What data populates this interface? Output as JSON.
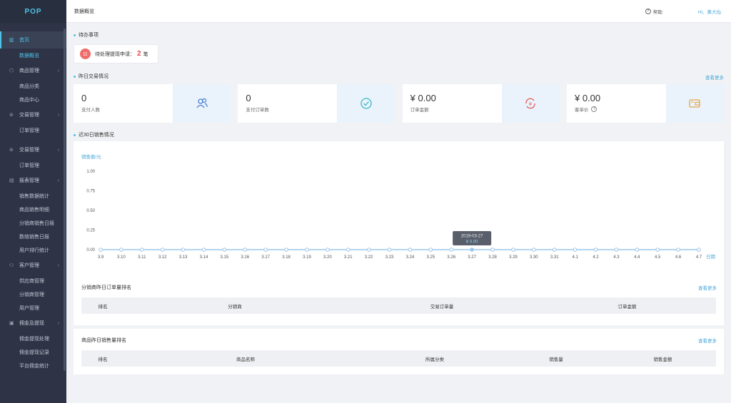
{
  "app": {
    "logo": "POP"
  },
  "topbar": {
    "breadcrumb": "数据概览",
    "help": "帮助",
    "user": "Hi、黄大仙"
  },
  "sidebar": {
    "groups": [
      {
        "icon": "chart-icon",
        "label": "首页",
        "active": true,
        "items": [
          "数据概览"
        ]
      },
      {
        "icon": "cube-icon",
        "label": "商品管理",
        "items": [
          "商品分类",
          "商品中心"
        ]
      },
      {
        "icon": "yen-icon",
        "label": "交易管理",
        "items": [
          "订单管理"
        ]
      },
      {
        "icon": "yen-icon",
        "label": "交易管理",
        "items": [
          "订单管理"
        ]
      },
      {
        "icon": "report-icon",
        "label": "报表管理",
        "items": [
          "销售数据统计",
          "商品销售明细",
          "分销商销售日报",
          "数络销售日报",
          "用户排行统计"
        ]
      },
      {
        "icon": "user-icon",
        "label": "客户管理",
        "items": [
          "供应商管理",
          "分销商管理",
          "用户管理"
        ]
      },
      {
        "icon": "wallet-icon",
        "label": "佣金及提现",
        "items": [
          "佣金提现处理",
          "佣金提现记录",
          "平台佣金统计"
        ]
      }
    ]
  },
  "todo": {
    "title": "待办事项",
    "label": "待处理提现申请：",
    "count": "2",
    "unit": "笔"
  },
  "yesterday": {
    "title": "昨日交易情况",
    "more": "查看更多",
    "cards": [
      {
        "value": "0",
        "label": "支付人数",
        "icon": "users-icon",
        "color": "#4a7fd8",
        "has_help": false
      },
      {
        "value": "0",
        "label": "支付订单数",
        "icon": "check-circle-icon",
        "color": "#3cb8c8",
        "has_help": false
      },
      {
        "value": "¥ 0.00",
        "label": "订单金额",
        "icon": "refresh-yen-icon",
        "color": "#e05a5a",
        "has_help": false
      },
      {
        "value": "¥ 0.00",
        "label": "客单价",
        "icon": "wallet-icon",
        "color": "#e8a34a",
        "has_help": true
      }
    ]
  },
  "sales30": {
    "title": "近30日销售情况"
  },
  "chart_data": {
    "type": "line",
    "ylabel": "销售额/元",
    "xlabel": "日期",
    "ylim": [
      0,
      1
    ],
    "y_ticks": [
      "0.00",
      "0.25",
      "0.50",
      "0.75",
      "1.00"
    ],
    "categories": [
      "3.9",
      "3.10",
      "3.11",
      "3.12",
      "3.13",
      "3.14",
      "3.15",
      "3.16",
      "3.17",
      "3.18",
      "3.19",
      "3.20",
      "3.21",
      "3.22",
      "3.23",
      "3.24",
      "3.25",
      "3.26",
      "3.27",
      "3.28",
      "3.29",
      "3.30",
      "3.31",
      "4.1",
      "4.2",
      "4.3",
      "4.4",
      "4.5",
      "4.6",
      "4.7"
    ],
    "series": [
      {
        "values": [
          0,
          0,
          0,
          0,
          0,
          0,
          0,
          0,
          0,
          0,
          0,
          0,
          0,
          0,
          0,
          0,
          0,
          0,
          0,
          0,
          0,
          0,
          0,
          0,
          0,
          0,
          0,
          0,
          0,
          0
        ]
      }
    ],
    "tooltip": {
      "index": 18,
      "date": "2019-03-27",
      "value": "¥ 0.00"
    },
    "line_color": "#9cc7ec"
  },
  "distributor_rank": {
    "title": "分销商昨日订单量排名",
    "more": "查看更多",
    "columns": [
      "排名",
      "分销商",
      "交易订单量",
      "订单金额"
    ]
  },
  "product_rank": {
    "title": "商品昨日销售量排名",
    "more": "查看更多",
    "columns": [
      "排名",
      "商品名称",
      "所属分类",
      "销售量",
      "销售金额"
    ]
  }
}
